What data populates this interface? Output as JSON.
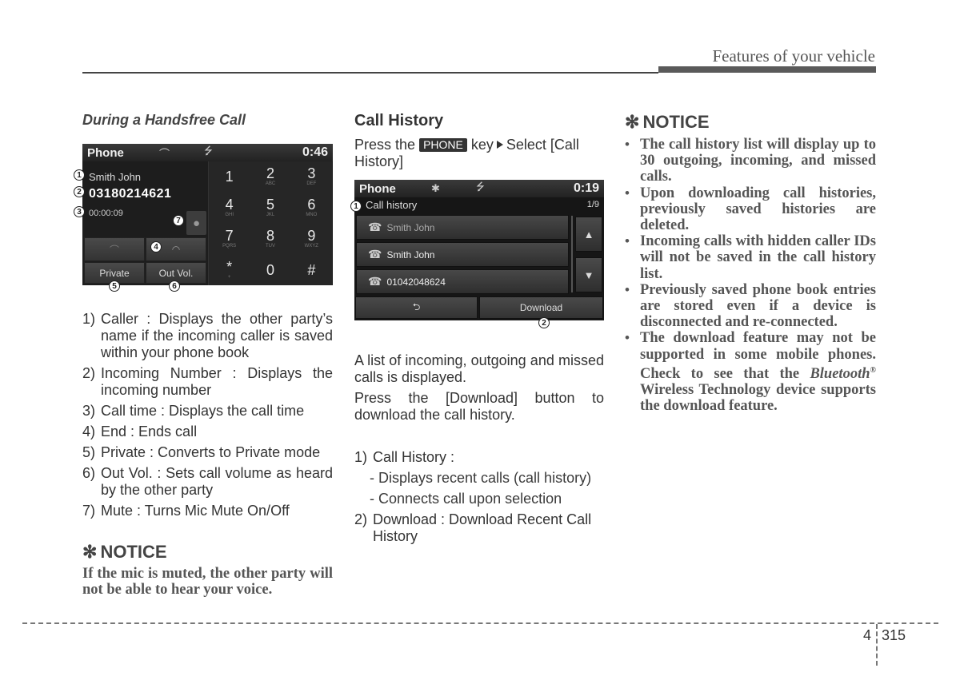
{
  "header": {
    "title": "Features of your vehicle"
  },
  "footer": {
    "chapter": "4",
    "page": "315"
  },
  "left": {
    "heading": "During a Handsfree Call",
    "screen": {
      "app_label": "Phone",
      "time": "0:46",
      "caller": "Smith John",
      "number": "03180214621",
      "call_time": "00:00:09",
      "private_label": "Private",
      "outvol_label": "Out Vol.",
      "keys": [
        {
          "d": "1",
          "l": ""
        },
        {
          "d": "2",
          "l": "ABC"
        },
        {
          "d": "3",
          "l": "DEF"
        },
        {
          "d": "4",
          "l": "GHI"
        },
        {
          "d": "5",
          "l": "JKL"
        },
        {
          "d": "6",
          "l": "MNO"
        },
        {
          "d": "7",
          "l": "PQRS"
        },
        {
          "d": "8",
          "l": "TUV"
        },
        {
          "d": "9",
          "l": "WXYZ"
        },
        {
          "d": "*",
          "l": "+"
        },
        {
          "d": "0",
          "l": ""
        },
        {
          "d": "#",
          "l": ""
        }
      ],
      "callouts": [
        "1",
        "2",
        "3",
        "4",
        "5",
        "6",
        "7"
      ]
    },
    "items": [
      {
        "n": "1)",
        "t": "Caller : Displays the other party’s name if the incoming caller is saved within your phone book"
      },
      {
        "n": "2)",
        "t": "Incoming Number : Displays the incoming number"
      },
      {
        "n": "3)",
        "t": "Call time : Displays the call time"
      },
      {
        "n": "4)",
        "t": "End : Ends call"
      },
      {
        "n": "5)",
        "t": "Private : Converts to Private mode"
      },
      {
        "n": "6)",
        "t": "Out Vol. : Sets call volume as heard by the other party"
      },
      {
        "n": "7)",
        "t": "Mute : Turns Mic Mute On/Off"
      }
    ],
    "notice": {
      "title": "NOTICE",
      "text": "If the mic is muted, the other party will not be able to hear your voice."
    }
  },
  "middle": {
    "heading": "Call History",
    "instr_pre": "Press the",
    "key_label": "PHONE",
    "instr_mid": "key",
    "instr_post": "Select [Call History]",
    "screen": {
      "app_label": "Phone",
      "time": "0:19",
      "subtitle": "Call history",
      "page": "1/9",
      "rows": [
        "Smith John",
        "Smith John",
        "01042048624"
      ],
      "download_label": "Download",
      "callouts": [
        "1",
        "2"
      ]
    },
    "para1": "A list of incoming, outgoing and missed calls is displayed.",
    "para2": "Press the [Download] button to download the call history.",
    "items": {
      "i1": {
        "n": "1)",
        "t": "Call History :"
      },
      "sub": [
        "- Displays recent calls (call history)",
        "- Connects call upon selection"
      ],
      "i2": {
        "n": "2)",
        "t": "Download : Download Recent Call History"
      }
    }
  },
  "right": {
    "notice_title": "NOTICE",
    "bullets": [
      "The call history list will display up to 30 outgoing, incoming, and missed calls.",
      "Upon downloading call histories, previously saved histories are deleted.",
      "Incoming calls with hidden caller IDs will not be saved in the call history list.",
      "Previously saved phone book entries are stored even if a device is disconnected and re-connected."
    ],
    "last_bullet": {
      "pre": "The download feature may not be supported in some mobile phones. Check to see that the",
      "italic": "Bluetooth",
      "reg": "®",
      "post": "Wireless Technology device supports the download feature."
    }
  }
}
